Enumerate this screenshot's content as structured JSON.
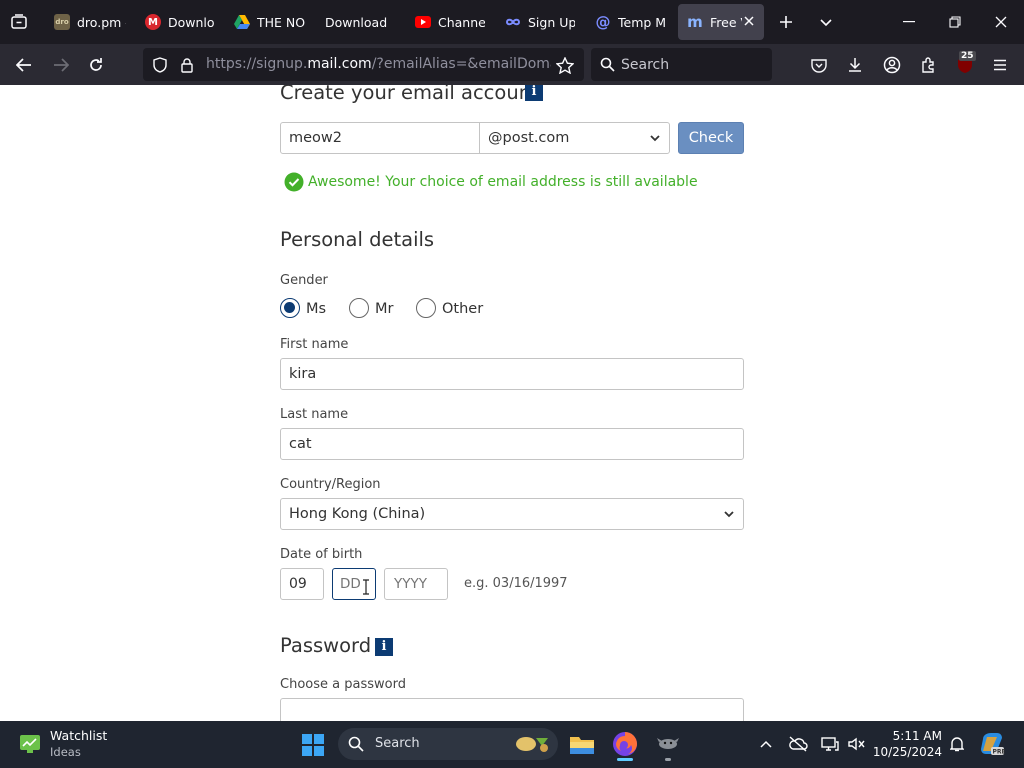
{
  "browser": {
    "tabs": [
      {
        "label": "dro.pm -",
        "favicon": "dro-icon",
        "color": "#8a7a55"
      },
      {
        "label": "Downlo",
        "favicon": "mega-icon",
        "color": "#d9272e"
      },
      {
        "label": "THE NO",
        "favicon": "google-drive-icon",
        "color": "#1fa463"
      },
      {
        "label": "Download",
        "favicon": "",
        "color": ""
      },
      {
        "label": "Channel",
        "favicon": "youtube-icon",
        "color": "#ff0000"
      },
      {
        "label": "Sign Up",
        "favicon": "infinity-icon",
        "color": "#7b8cff"
      },
      {
        "label": "Temp M",
        "favicon": "at-sign-icon",
        "color": "#7b8cff"
      },
      {
        "label": "Free V",
        "favicon": "m-logo-icon",
        "color": "#8ab4ff"
      }
    ],
    "url_prefix": "https://signup.",
    "url_domain": "mail.com",
    "url_rest": "/?emailAlias=&emailDomain=m",
    "search_placeholder": "Search",
    "extension_badge": "25"
  },
  "form": {
    "create_heading": "Create your email account",
    "info_glyph": "i",
    "email_alias": "meow2",
    "email_domain": "@post.com",
    "check_button": "Check",
    "availability_message": "Awesome! Your choice of email address is still available",
    "personal_heading": "Personal details",
    "gender_label": "Gender",
    "gender_options": [
      "Ms",
      "Mr",
      "Other"
    ],
    "gender_selected": "Ms",
    "first_name_label": "First name",
    "first_name": "kira",
    "last_name_label": "Last name",
    "last_name": "cat",
    "country_label": "Country/Region",
    "country": "Hong Kong (China)",
    "dob_label": "Date of birth",
    "dob_month": "09",
    "dob_day_placeholder": "DD",
    "dob_year_placeholder": "YYYY",
    "dob_example": "e.g. 03/16/1997",
    "password_heading": "Password",
    "choose_password_label": "Choose a password"
  },
  "taskbar": {
    "widget_title": "Watchlist",
    "widget_subtitle": "Ideas",
    "search_label": "Search",
    "time": "5:11 AM",
    "date": "10/25/2024"
  },
  "colors": {
    "accent": "#0c3b73",
    "check_button": "#6a8fc1",
    "success": "#43b02a"
  }
}
